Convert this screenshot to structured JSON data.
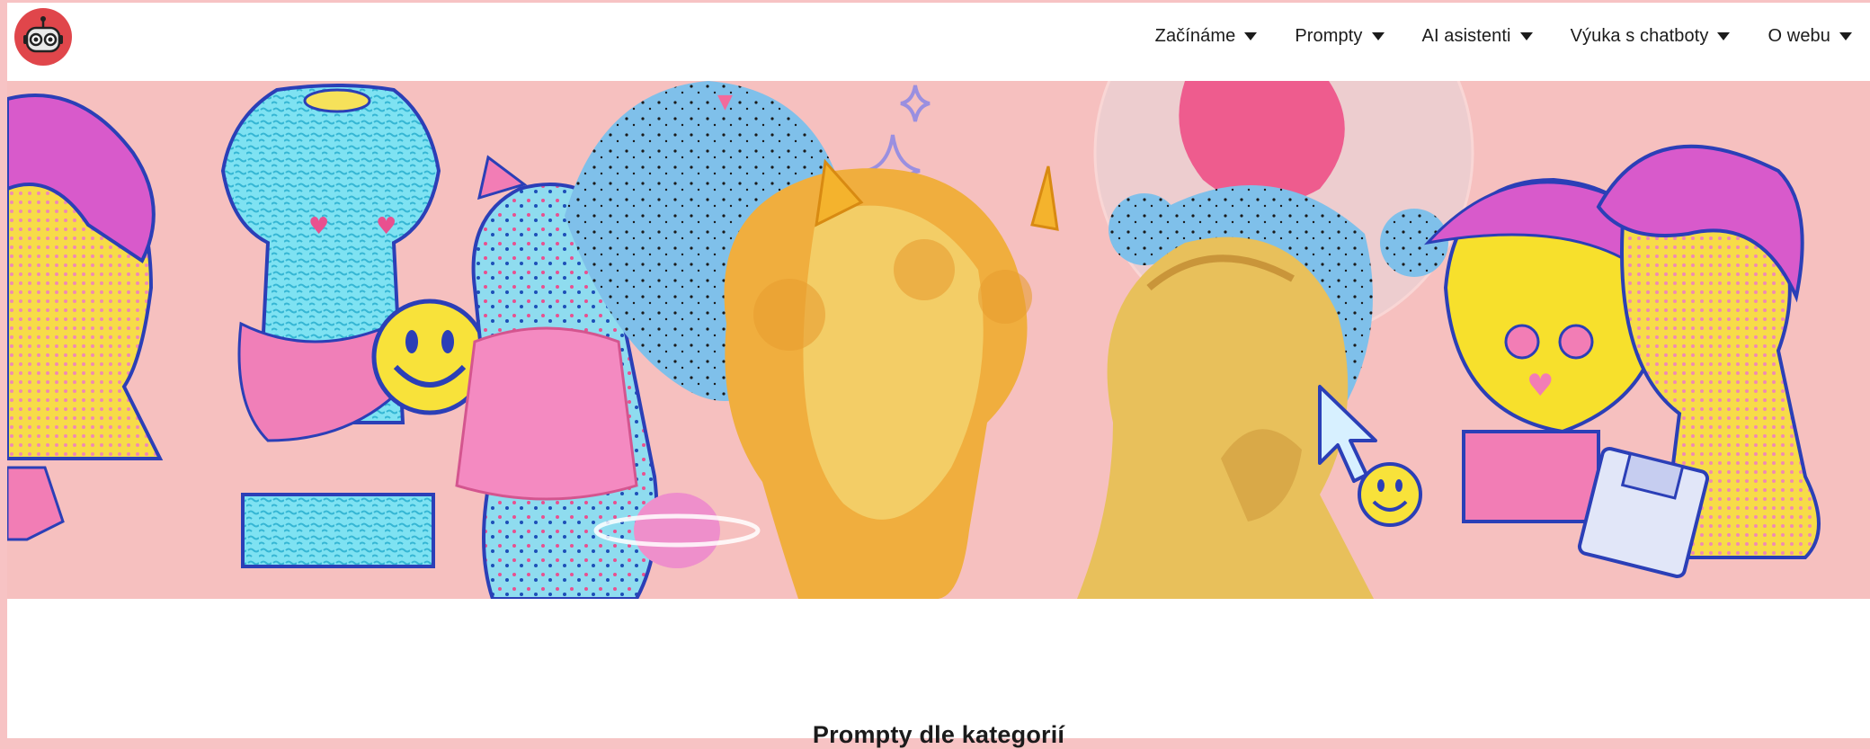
{
  "nav": {
    "items": [
      {
        "label": "Začínáme"
      },
      {
        "label": "Prompty"
      },
      {
        "label": "AI asistenti"
      },
      {
        "label": "Výuka s chatboty"
      },
      {
        "label": "O webu"
      }
    ]
  },
  "sections": {
    "title": "Prompty dle kategorií"
  },
  "colors": {
    "background": "#f6c0bf",
    "logo": "#e0464b",
    "text": "#1b1b1b"
  }
}
